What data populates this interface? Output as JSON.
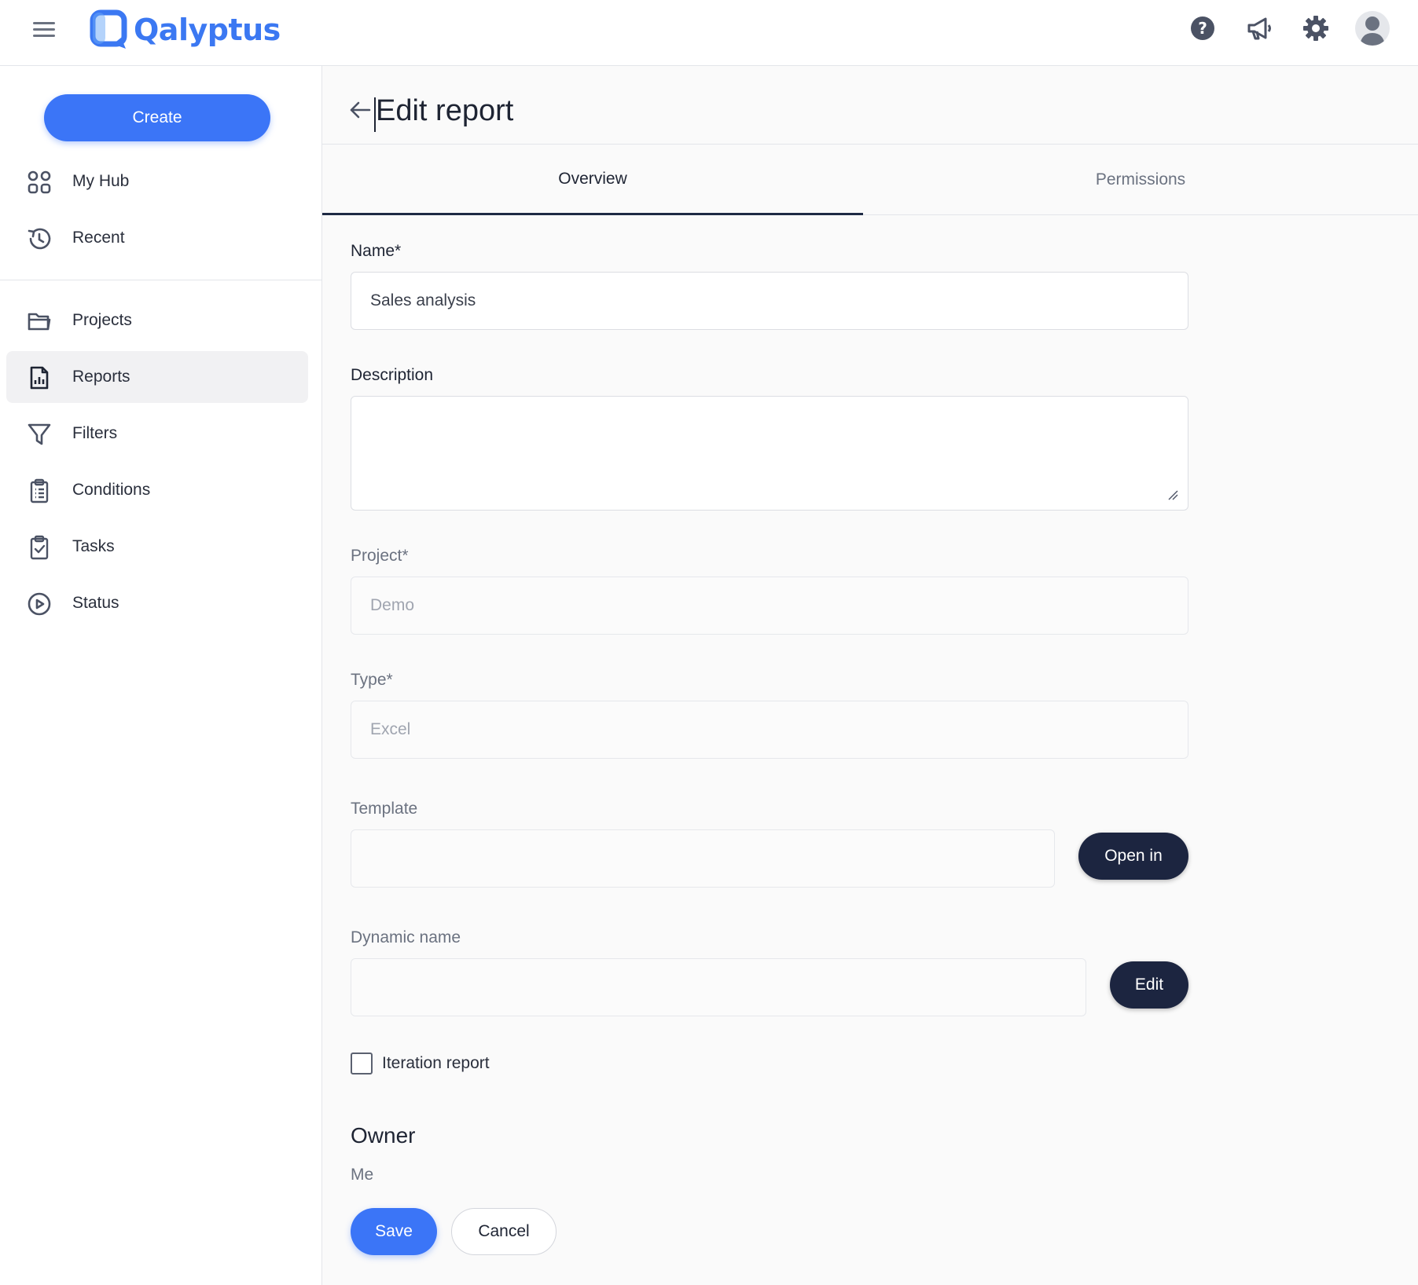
{
  "app": {
    "name": "Qalyptus"
  },
  "topbar": {
    "menu_icon": "hamburger-menu-icon",
    "icons": [
      "help-icon",
      "megaphone-icon",
      "gear-icon",
      "user-avatar-icon"
    ]
  },
  "sidebar": {
    "create_label": "Create",
    "items": [
      {
        "label": "My Hub",
        "icon": "grid-icon"
      },
      {
        "label": "Recent",
        "icon": "history-icon"
      },
      {
        "label": "Projects",
        "icon": "folder-icon"
      },
      {
        "label": "Reports",
        "icon": "report-icon",
        "active": true
      },
      {
        "label": "Filters",
        "icon": "funnel-icon"
      },
      {
        "label": "Conditions",
        "icon": "clipboard-list-icon"
      },
      {
        "label": "Tasks",
        "icon": "clipboard-check-icon"
      },
      {
        "label": "Status",
        "icon": "play-circle-icon"
      }
    ]
  },
  "page": {
    "title": "Edit report",
    "tabs": [
      {
        "label": "Overview",
        "active": true
      },
      {
        "label": "Permissions",
        "active": false
      }
    ]
  },
  "form": {
    "name": {
      "label": "Name*",
      "value": "Sales analysis"
    },
    "description": {
      "label": "Description",
      "value": ""
    },
    "project": {
      "label": "Project*",
      "value": "Demo"
    },
    "type": {
      "label": "Type*",
      "value": "Excel"
    },
    "template": {
      "label": "Template",
      "value": "",
      "button": "Open in"
    },
    "dynamic_name": {
      "label": "Dynamic name",
      "value": "",
      "button": "Edit"
    },
    "iteration": {
      "label": "Iteration report",
      "checked": false
    },
    "owner": {
      "heading": "Owner",
      "value": "Me"
    },
    "save_label": "Save",
    "cancel_label": "Cancel"
  },
  "colors": {
    "brand": "#3b78f2",
    "primary_button": "#3b75f7",
    "dark_button": "#1c2540"
  }
}
